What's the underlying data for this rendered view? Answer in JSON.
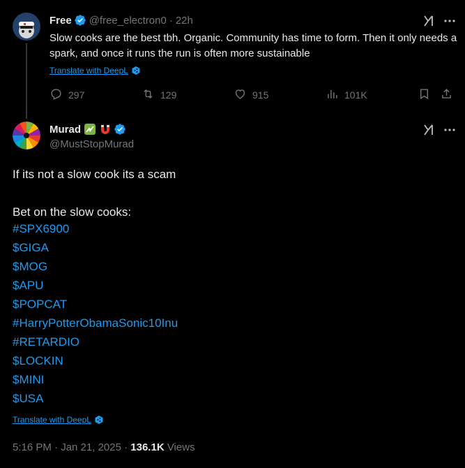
{
  "parent_post": {
    "display_name": "Free",
    "handle": "@free_electron0",
    "separator": "·",
    "time": "22h",
    "text": "Slow cooks are the best tbh. Organic. Community has time to form. Then it only needs a spark, and once it runs the run is often more sustainable",
    "translate_label": "Translate with DeepL",
    "actions": {
      "replies": "297",
      "reposts": "129",
      "likes": "915",
      "views": "101K"
    }
  },
  "main_post": {
    "display_name": "Murad",
    "handle": "@MustStopMurad",
    "text": "If its not a slow cook its a scam",
    "intro": "Bet on the slow cooks:",
    "tags": [
      "#SPX6900",
      "$GIGA",
      "$MOG",
      "$APU",
      "$POPCAT",
      "#HarryPotterObamaSonic10Inu",
      "#RETARDIO",
      "$LOCKIN",
      "$MINI",
      "$USA"
    ],
    "translate_label": "Translate with DeepL",
    "timestamp": "5:16 PM · Jan 21, 2025",
    "dot": "·",
    "views_count": "136.1K",
    "views_label": "Views"
  },
  "icons": {
    "verified": "verified-badge-icon",
    "deepl": "deepl-icon",
    "grok": "grok-icon",
    "more": "more-icon",
    "reply": "reply-icon",
    "repost": "repost-icon",
    "like": "like-icon",
    "views": "views-icon",
    "bookmark": "bookmark-icon",
    "share": "share-icon"
  },
  "colors": {
    "background": "#000000",
    "text": "#e7e9ea",
    "muted": "#71767b",
    "accent": "#1d9bf0"
  }
}
